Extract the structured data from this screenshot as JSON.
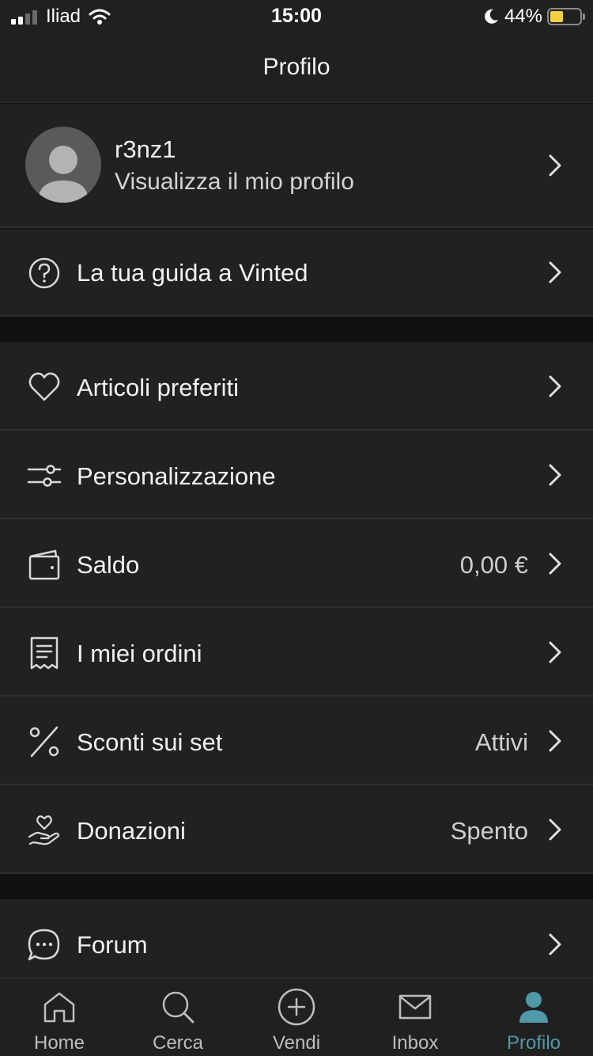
{
  "status_bar": {
    "carrier": "Iliad",
    "time": "15:00",
    "battery_pct": "44%",
    "battery_level": 0.44,
    "signal_bars": 2,
    "icons": [
      "signal-icon",
      "wifi-icon",
      "moon-icon",
      "battery-icon"
    ]
  },
  "header": {
    "title": "Profilo"
  },
  "profile": {
    "username": "r3nz1",
    "subtitle": "Visualizza il mio profilo"
  },
  "guide": {
    "label": "La tua guida a Vinted",
    "icon": "question-circle-icon"
  },
  "menu": [
    {
      "label": "Articoli preferiti",
      "value": "",
      "icon": "heart-icon"
    },
    {
      "label": "Personalizzazione",
      "value": "",
      "icon": "sliders-icon"
    },
    {
      "label": "Saldo",
      "value": "0,00 €",
      "icon": "wallet-icon"
    },
    {
      "label": "I miei ordini",
      "value": "",
      "icon": "receipt-icon"
    },
    {
      "label": "Sconti sui set",
      "value": "Attivi",
      "icon": "percent-icon"
    },
    {
      "label": "Donazioni",
      "value": "Spento",
      "icon": "donation-hand-icon"
    }
  ],
  "forum": {
    "label": "Forum",
    "icon": "chat-bubble-icon"
  },
  "tabs": [
    {
      "label": "Home",
      "icon": "home-icon",
      "active": false
    },
    {
      "label": "Cerca",
      "icon": "search-icon",
      "active": false
    },
    {
      "label": "Vendi",
      "icon": "plus-circle-icon",
      "active": false
    },
    {
      "label": "Inbox",
      "icon": "mail-icon",
      "active": false
    },
    {
      "label": "Profilo",
      "icon": "profile-icon",
      "active": true
    }
  ],
  "colors": {
    "background": "#111111",
    "row": "#212121",
    "text": "#f1f1f1",
    "secondary_text": "#cfcfcf",
    "active_tab": "#4f99a8",
    "battery": "#f4d03f"
  }
}
